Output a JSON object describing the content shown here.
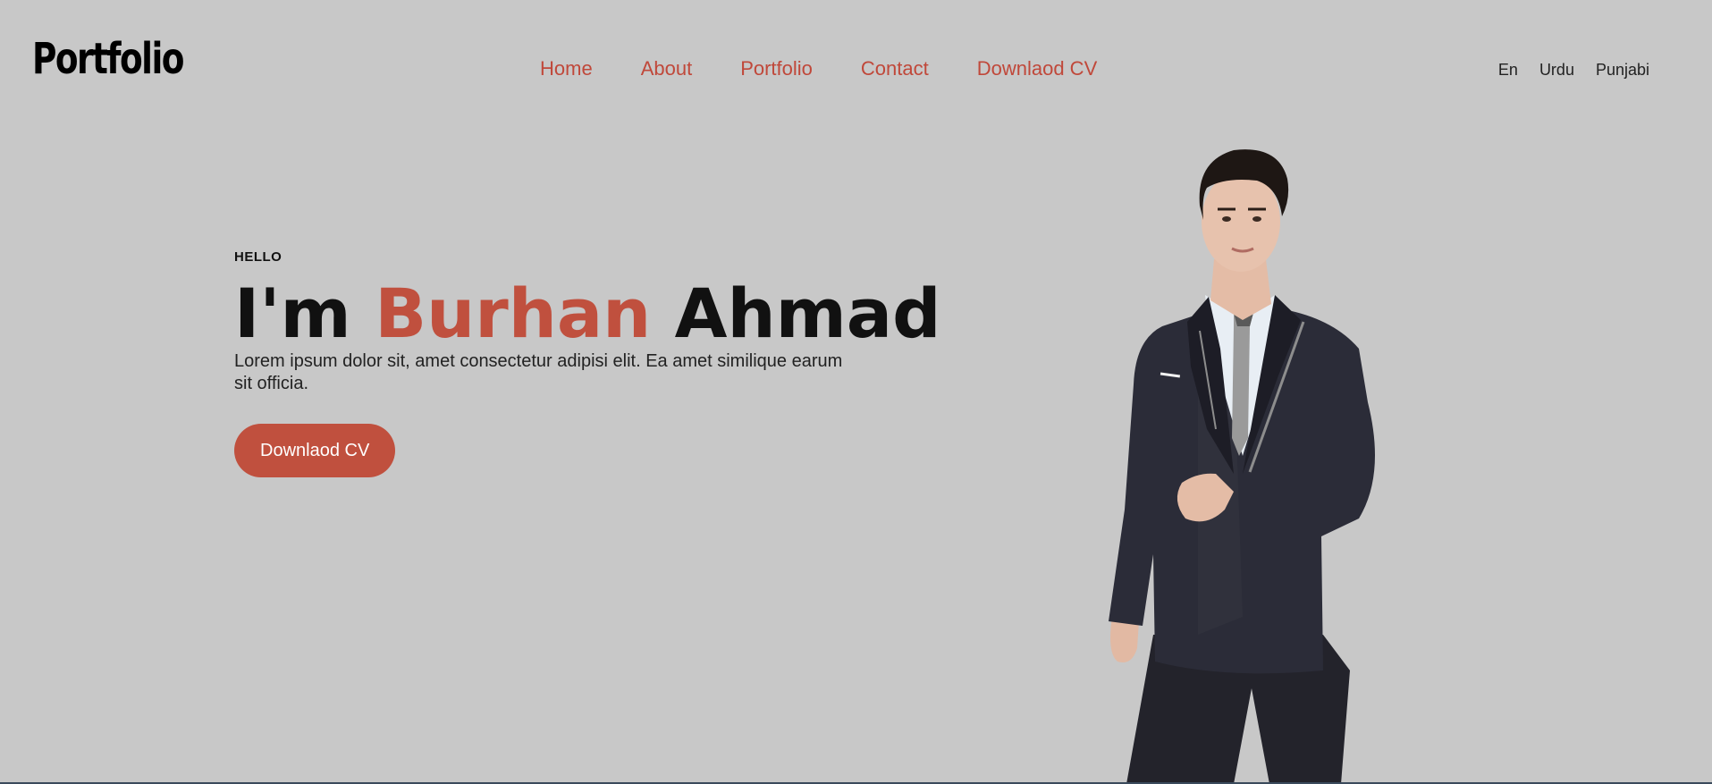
{
  "header": {
    "logo_text": "Portfolio",
    "nav": [
      {
        "label": "Home"
      },
      {
        "label": "About"
      },
      {
        "label": "Portfolio"
      },
      {
        "label": "Contact"
      },
      {
        "label": "Downlaod CV"
      }
    ],
    "languages": [
      {
        "label": "En"
      },
      {
        "label": "Urdu"
      },
      {
        "label": "Punjabi"
      }
    ]
  },
  "hero": {
    "eyebrow": "HELLO",
    "headline_prefix": "I'm ",
    "headline_accent": "Burhan",
    "headline_suffix": " Ahmad",
    "description": "Lorem ipsum dolor sit, amet consectetur adipisi elit. Ea amet similique earum sit officia.",
    "cta_label": "Downlaod CV"
  },
  "colors": {
    "background": "#c8c8c8",
    "accent": "#c0503e",
    "nav_link": "#c0483a",
    "text": "#111111"
  },
  "image": {
    "subject": "man-in-suit-photo"
  }
}
